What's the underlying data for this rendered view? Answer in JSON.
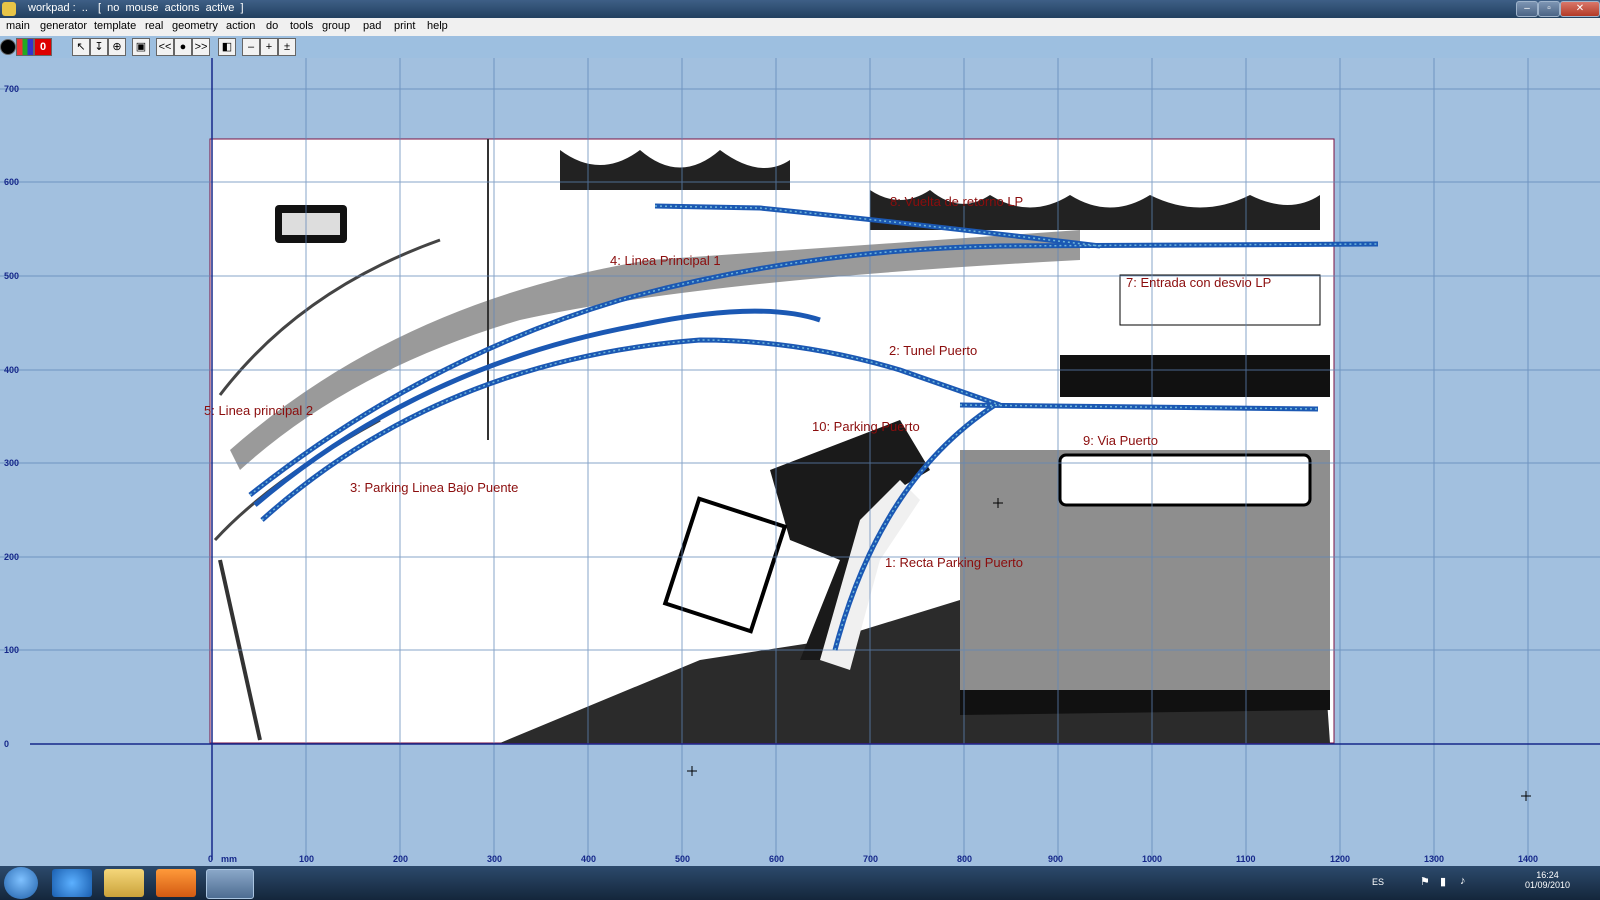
{
  "window": {
    "title": "workpad :  ..",
    "status": "[  no  mouse  actions  active  ]",
    "buttons": [
      "–",
      "▫",
      "✕"
    ]
  },
  "menu": [
    "main",
    "generator",
    "template",
    "real",
    "geometry",
    "action",
    "do",
    "tools",
    "group",
    "pad",
    "print",
    "help"
  ],
  "toolbar": {
    "counter": "0",
    "buttons": [
      "<<",
      "●",
      ">>"
    ]
  },
  "axis": {
    "unit": "mm",
    "x_ticks": [
      "0",
      "100",
      "200",
      "300",
      "400",
      "500",
      "600",
      "700",
      "800",
      "900",
      "1000",
      "1100",
      "1200",
      "1300",
      "1400"
    ],
    "y_ticks": [
      "700",
      "600",
      "500",
      "400",
      "300",
      "200",
      "100",
      "0"
    ]
  },
  "labels": {
    "t1": "1: Recta Parking Puerto",
    "t2": "2: Tunel Puerto",
    "t3": "3: Parking Linea Bajo Puente",
    "t4": "4: Linea Principal 1",
    "t5": "5: Linea principal 2",
    "t7": "7: Entrada con desvio LP",
    "t8": "8: Vuelta de retorno LP",
    "t9": "9: Via Puerto",
    "t10": "10: Parking Puerto"
  },
  "taskbar": {
    "language": "ES",
    "time": "16:24",
    "date": "01/09/2010",
    "apps": [
      "start-button",
      "internet-explorer",
      "explorer",
      "media-player",
      "templot"
    ]
  },
  "colors": {
    "canvas": "#a2c0df",
    "grid": "#5f86b8",
    "track": "#1b58b3",
    "label": "#8b0d0d"
  }
}
